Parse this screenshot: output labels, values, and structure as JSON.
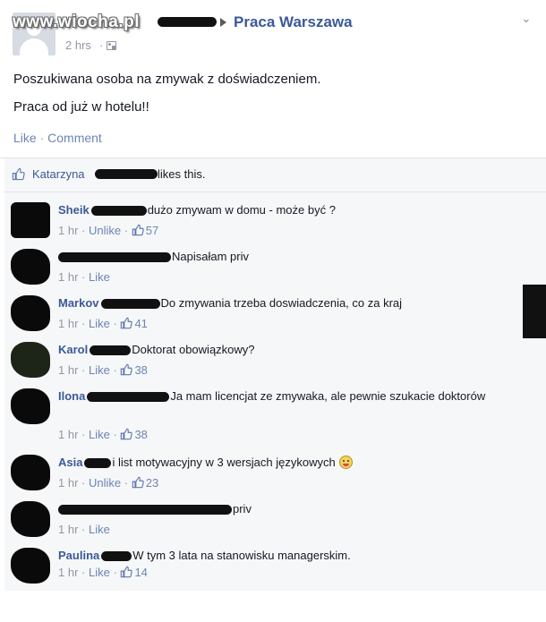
{
  "post": {
    "watermark": "www.wiocha.pl",
    "group_name": "Praca Warszawa",
    "time": "2 hrs",
    "time_sep": "·",
    "line1": "Poszukiwana osoba na zmywak z doświadczeniem.",
    "line2": "Praca od już w hotelu!!",
    "action_like": "Like",
    "action_sep": "·",
    "action_comment": "Comment"
  },
  "likes": {
    "name": "Katarzyna",
    "suffix": "likes this."
  },
  "comments": [
    {
      "name": "Sheik",
      "text": "dużo zmywam w domu - może być ?",
      "time": "1 hr",
      "action": "Unlike",
      "count": "57"
    },
    {
      "name": "",
      "text": "Napisałam priv",
      "time": "1 hr",
      "action": "Like",
      "count": ""
    },
    {
      "name": "Markov",
      "text": "Do zmywania trzeba doswiadczenia, co za kraj",
      "time": "1 hr",
      "action": "Like",
      "count": "41"
    },
    {
      "name": "Karol",
      "text": "Doktorat obowiązkowy?",
      "time": "1 hr",
      "action": "Like",
      "count": "38"
    },
    {
      "name": "Ilona",
      "text": "Ja mam licencjat ze zmywaka, ale pewnie szukacie doktorów",
      "time": "1 hr",
      "action": "Like",
      "count": "38"
    },
    {
      "name": "Asia",
      "text": "i list motywacyjny w 3 wersjach językowych",
      "time": "1 hr",
      "action": "Unlike",
      "count": "23"
    },
    {
      "name": "",
      "text": "priv",
      "time": "1 hr",
      "action": "Like",
      "count": ""
    },
    {
      "name": "Paulina",
      "text": "W tym 3 lata na stanowisku managerskim.",
      "time": "1 hr",
      "action": "Like",
      "count": "14"
    }
  ],
  "meta_sep": "·",
  "colors": {
    "link": "#3b5998",
    "muted": "#9197a3",
    "action": "#6d84b4"
  }
}
